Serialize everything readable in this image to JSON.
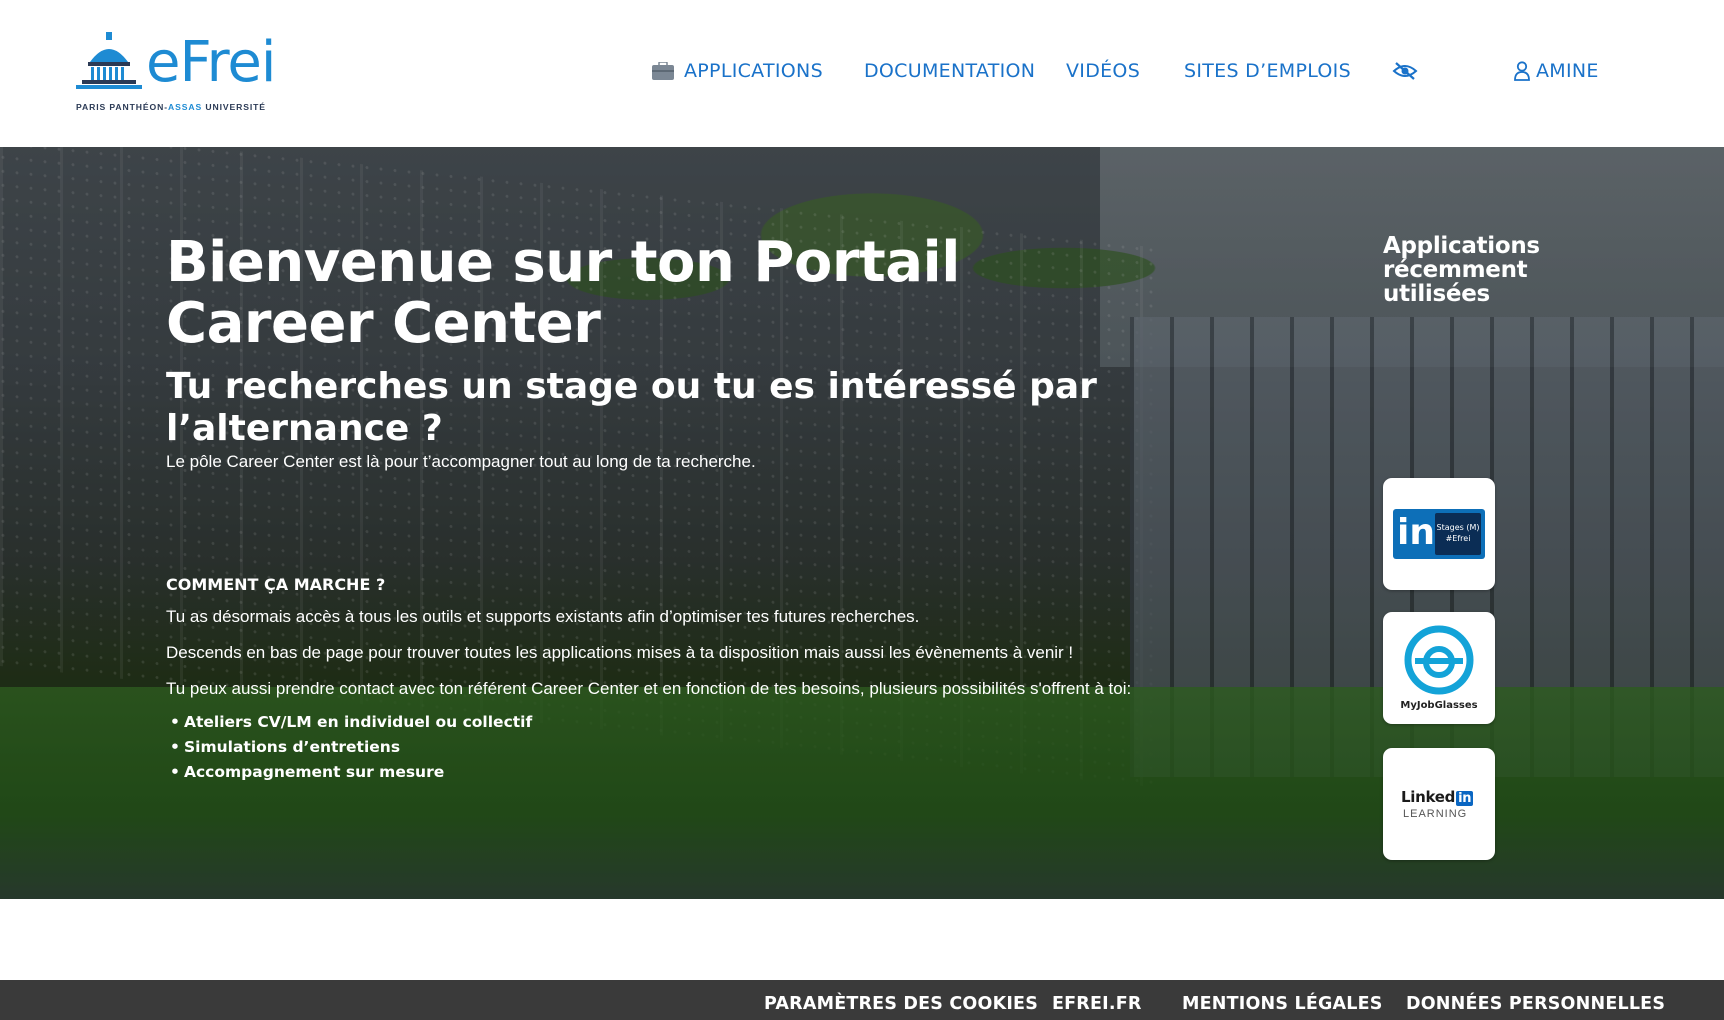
{
  "brand": {
    "logo_text": "eFrei",
    "tagline_before": "PARIS PANTHÉON-",
    "tagline_accent": "ASSAS",
    "tagline_after": " UNIVERSITÉ",
    "color": "#1e8bd3"
  },
  "nav": {
    "applications": "APPLICATIONS",
    "documentation": "DOCUMENTATION",
    "videos": "VIDÉOS",
    "sites_emplois": "SITES D’EMPLOIS",
    "visibility_icon": "eye-slash-icon",
    "user": "AMINE",
    "color": "#1a72c9"
  },
  "hero": {
    "title": "Bienvenue sur ton Portail Career Center",
    "subtitle": "Tu recherches un stage ou tu es intéressé par l’alternance ?",
    "intro": "Le pôle Career Center est là pour t’accompagner tout au long de ta recherche.",
    "how_title": "COMMENT ÇA MARCHE ?",
    "paragraphs": [
      "Tu as désormais accès à tous les outils et supports existants afin d’optimiser tes futures recherches.",
      "Descends en bas de page pour trouver toutes les applications mises à ta disposition mais aussi les évènements à venir !",
      "Tu peux aussi prendre contact avec ton référent Career Center et en fonction de tes besoins, plusieurs possibilités s'offrent à toi:"
    ],
    "list": [
      "Ateliers CV/LM en individuel ou collectif",
      "Simulations d’entretiens",
      "Accompagnement sur mesure"
    ]
  },
  "recent_apps": {
    "title": "Applications récemment utilisées",
    "apps": [
      {
        "name": "linkedin-stages",
        "badge_in": "in",
        "badge_text_1": "Stages (M)",
        "badge_text_2": "#Efrei"
      },
      {
        "name": "myjobglasses",
        "label": "MyJobGlasses"
      },
      {
        "name": "linkedin-learning",
        "word": "Linked",
        "in": "in",
        "sub": "LEARNING"
      }
    ]
  },
  "footer": {
    "links": [
      "PARAMÈTRES DES COOKIES",
      "EFREI.FR",
      "MENTIONS LÉGALES",
      "DONNÉES PERSONNELLES"
    ],
    "background": "#3a3a3a"
  }
}
